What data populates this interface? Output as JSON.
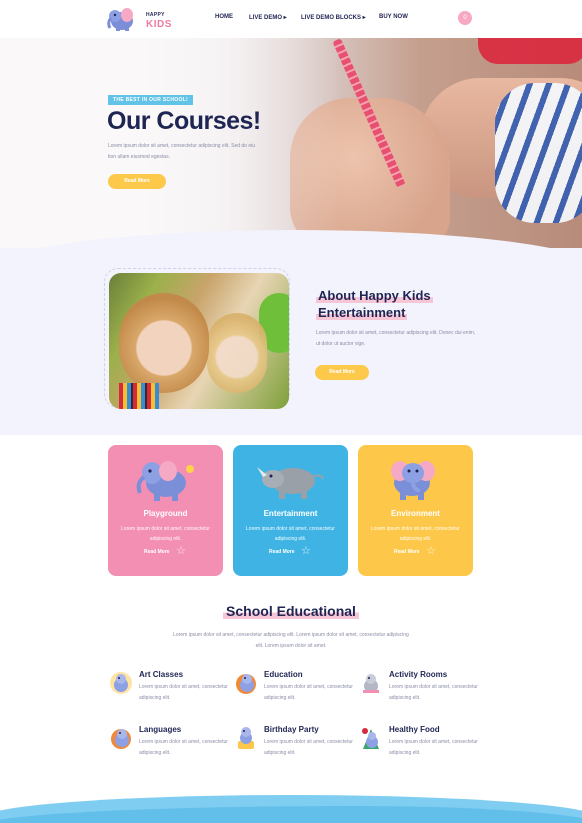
{
  "header": {
    "brand_small": "HAPPY",
    "brand": "KIDS",
    "nav": [
      "HOME",
      "LIVE DEMO ▸",
      "LIVE DEMO BLOCKS ▸",
      "BUY NOW"
    ],
    "cart_count": "0"
  },
  "hero": {
    "badge": "THE BEST IN OUR SCHOOL!",
    "title": "Our Courses!",
    "text": "Lorem ipsum dolor sit amet, consectetur adipiscing elit. Sed do eiu tion ullam eiusmod egestas.",
    "button": "Read More"
  },
  "about": {
    "title_line1": "About Happy Kids",
    "title_line2": "Entertainment",
    "text": "Lorem ipsum dolor sit amet, consectetur adipiscing elit. Donec dui enim, ut dolor ut auctor vige.",
    "button": "Read More"
  },
  "cards": [
    {
      "title": "Playground",
      "text": "Lorem ipsum dolor sit amet, consectetur adipiscing elit.",
      "more": "Read More",
      "color": "#f38fb2"
    },
    {
      "title": "Entertainment",
      "text": "Lorem ipsum dolor sit amet, consectetur adipiscing elit.",
      "more": "Read More",
      "color": "#3fb4e4"
    },
    {
      "title": "Environment",
      "text": "Lorem ipsum dolor sit amet, consectetur adipiscing elit.",
      "more": "Read More",
      "color": "#fdc84a"
    }
  ],
  "section": {
    "title": "School Educational",
    "text": "Lorem ipsum dolor sit amet, consectetur adipiscing elit. Lorem ipsum dolor sit amet, consectetur adipiscing elit. Lorem ipsum dolor sit amet."
  },
  "features": [
    {
      "title": "Art Classes",
      "text": "Lorem ipsum dolor sit amet, consectetur adipiscing elit."
    },
    {
      "title": "Education",
      "text": "Lorem ipsum dolor sit amet, consectetur adipiscing elit."
    },
    {
      "title": "Activity Rooms",
      "text": "Lorem ipsum dolor sit amet, consectetur adipiscing elit."
    },
    {
      "title": "Languages",
      "text": "Lorem ipsum dolor sit amet, consectetur adipiscing elit."
    },
    {
      "title": "Birthday Party",
      "text": "Lorem ipsum dolor sit amet, consectetur adipiscing elit."
    },
    {
      "title": "Healthy Food",
      "text": "Lorem ipsum dolor sit amet, consectetur adipiscing elit."
    }
  ],
  "colors": {
    "navy": "#1f2553",
    "pink": "#f38fb2",
    "blue": "#3fb4e4",
    "yellow": "#fdc84a",
    "badge": "#62c3e9"
  }
}
